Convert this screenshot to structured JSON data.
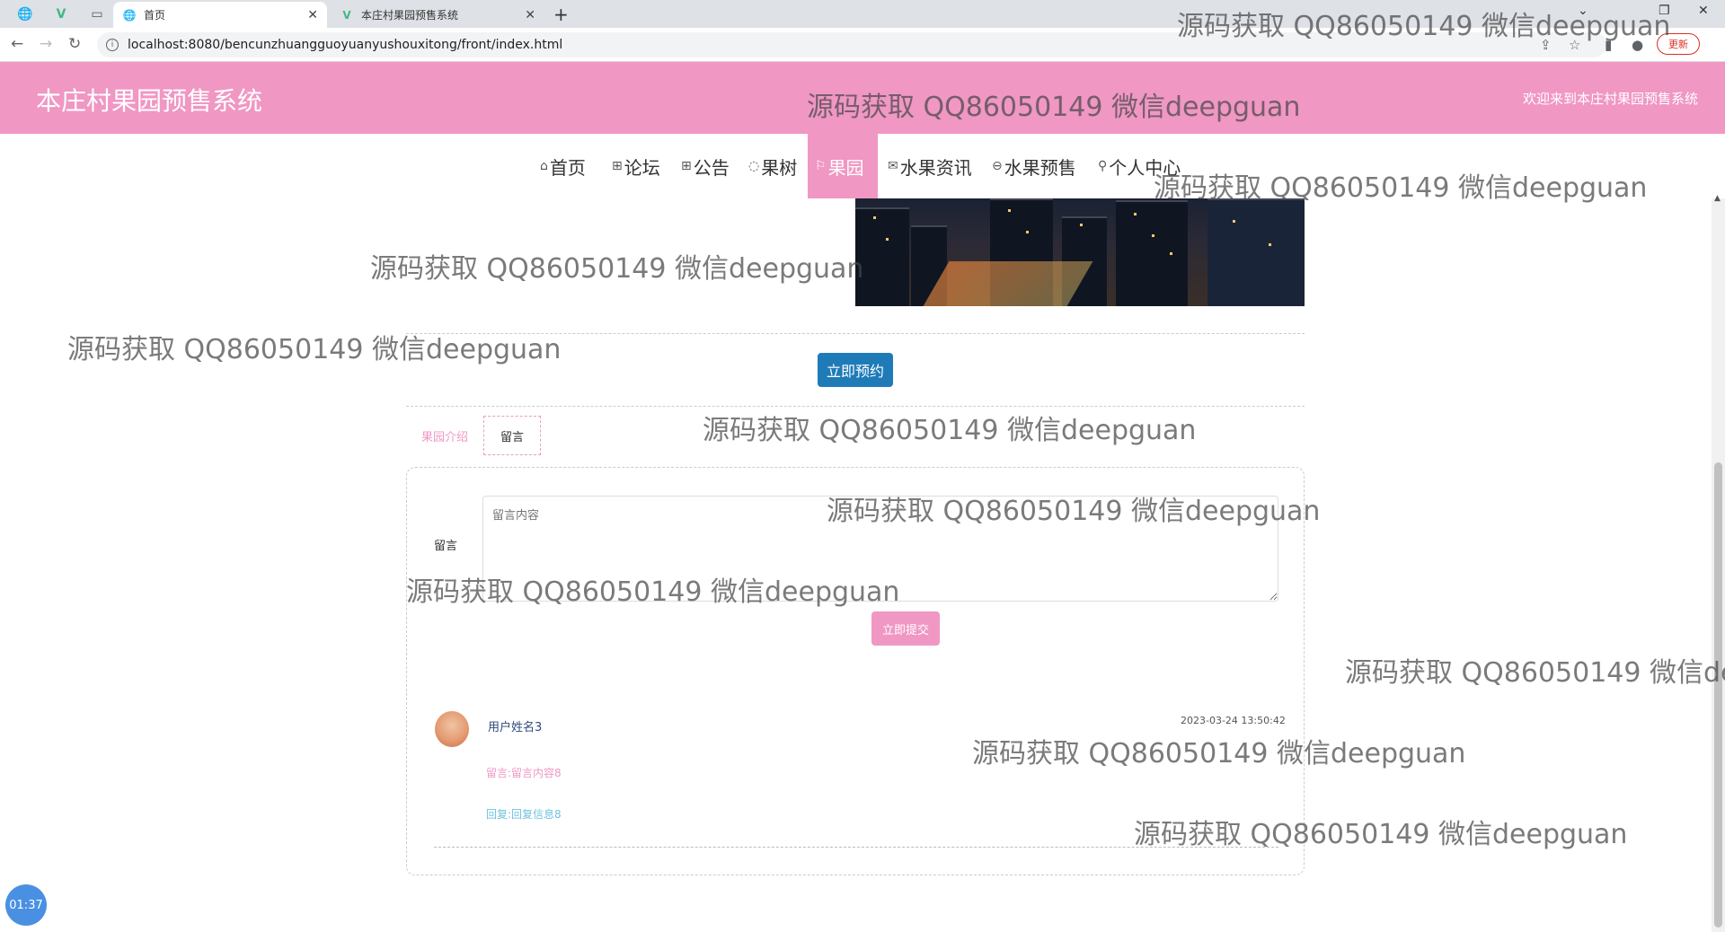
{
  "browser": {
    "tabs": [
      {
        "label": "首页",
        "active": true
      },
      {
        "label": "本庄村果园预售系统",
        "active": false
      }
    ],
    "url": "localhost:8080/bencunzhuangguoyuanyushouxitong/front/index.html",
    "update_label": "更新"
  },
  "header": {
    "title": "本庄村果园预售系统",
    "welcome": "欢迎来到本庄村果园预售系统"
  },
  "nav": {
    "items": [
      {
        "label": "首页",
        "icon": "⌂"
      },
      {
        "label": "论坛",
        "icon": "⊞"
      },
      {
        "label": "公告",
        "icon": "⊞"
      },
      {
        "label": "果树",
        "icon": "◌"
      },
      {
        "label": "果园",
        "icon": "⚐"
      },
      {
        "label": "水果资讯",
        "icon": "✉"
      },
      {
        "label": "水果预售",
        "icon": "⊖"
      },
      {
        "label": "个人中心",
        "icon": "⚲"
      }
    ]
  },
  "main": {
    "reserve_label": "立即预约",
    "tabs": [
      "果园介绍",
      "留言"
    ],
    "form": {
      "label": "留言",
      "placeholder": "留言内容",
      "submit_label": "立即提交"
    },
    "message": {
      "user": "用户姓名3",
      "time": "2023-03-24 13:50:42",
      "content": "留言:留言内容8",
      "reply": "回复:回复信息8"
    }
  },
  "timer": "01:37",
  "watermark": "源码获取 QQ86050149 微信deepguan",
  "watermark_cut": "源码获取 QQ86050149 微信de",
  "colors": {
    "pink": "#f097c4",
    "blue_button": "#1f7bb8",
    "reply": "#6fc3df"
  }
}
